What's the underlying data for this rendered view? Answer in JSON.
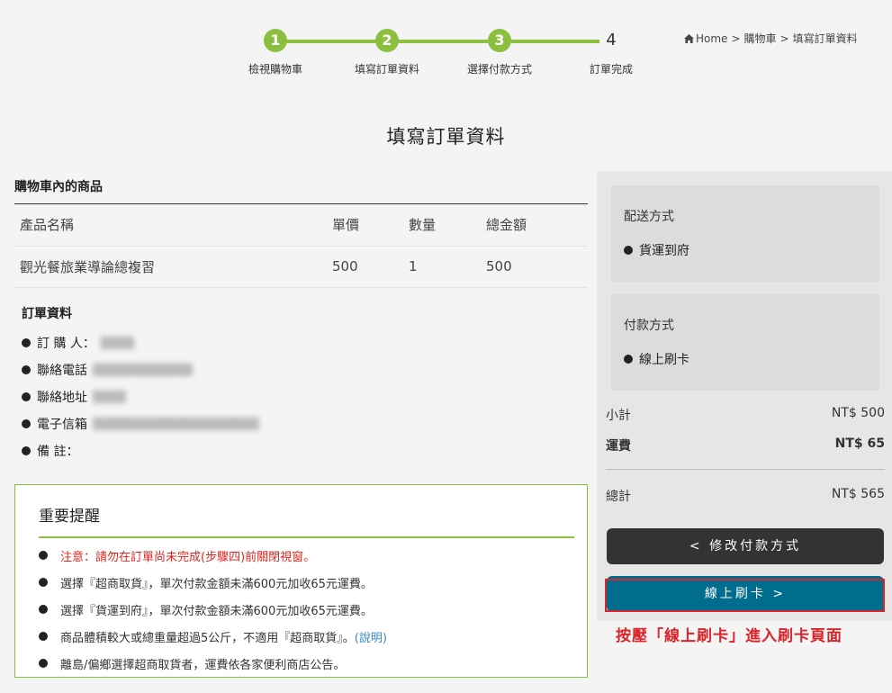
{
  "steps": [
    {
      "num": "1",
      "label": "檢視購物車"
    },
    {
      "num": "2",
      "label": "填寫訂單資料"
    },
    {
      "num": "3",
      "label": "選擇付款方式"
    },
    {
      "num": "4",
      "label": "訂單完成"
    }
  ],
  "breadcrumb": {
    "home": "Home",
    "cart": "購物車",
    "current": "填寫訂單資料",
    "sep": ">"
  },
  "page_title": "填寫訂單資料",
  "cart": {
    "heading": "購物車內的商品",
    "columns": [
      "產品名稱",
      "單價",
      "數量",
      "總金額"
    ],
    "rows": [
      {
        "name": "觀光餐旅業導論總複習",
        "price": "500",
        "qty": "1",
        "total": "500"
      }
    ]
  },
  "order_info": {
    "heading": "訂單資料",
    "fields": [
      {
        "label": "訂 購 人："
      },
      {
        "label": "聯絡電話"
      },
      {
        "label": "聯絡地址"
      },
      {
        "label": "電子信箱"
      },
      {
        "label": "備 註："
      }
    ]
  },
  "reminder": {
    "heading": "重要提醒",
    "items": [
      "注意：請勿在訂單尚未完成(步驟四)前關閉視窗。",
      "選擇『超商取貨』，單次付款金額未滿600元加收65元運費。",
      "選擇『貨運到府』，單次付款金額未滿600元加收65元運費。",
      "商品體積較大或總重量超過5公斤，不適用『超商取貨』。",
      "離島/偏鄉選擇超商取貨者，運費依各家便利商店公告。"
    ],
    "link_text": "(說明)"
  },
  "shipping": {
    "title": "配送方式",
    "value": "貨運到府"
  },
  "payment": {
    "title": "付款方式",
    "value": "線上刷卡"
  },
  "summary": {
    "subtotal_label": "小計",
    "subtotal": "NT$ 500",
    "shipping_label": "運費",
    "shipping": "NT$ 65",
    "total_label": "總計",
    "total": "NT$ 565"
  },
  "buttons": {
    "modify_payment": "<  修改付款方式",
    "pay_online": "線上刷卡  >"
  },
  "annotation": "按壓「線上刷卡」進入刷卡頁面",
  "colors": {
    "accent": "#8cbf3f",
    "warn": "#e0261f",
    "primary_button": "#006d8f",
    "dark_button": "#333333"
  }
}
